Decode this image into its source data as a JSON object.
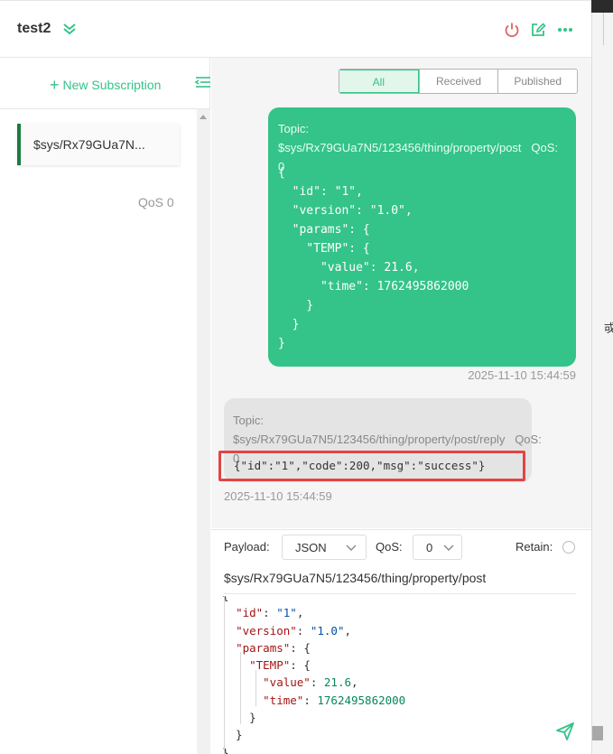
{
  "connection": {
    "name": "test2"
  },
  "header_icons": [
    "power-icon",
    "edit-icon",
    "more-icon"
  ],
  "subscriptions": {
    "new_label": "New Subscription",
    "items": [
      {
        "topic": "$sys/Rx79GUa7N...",
        "qos": "QoS 0"
      }
    ]
  },
  "filters": [
    "All",
    "Received",
    "Published"
  ],
  "messages": {
    "published": {
      "topic": "Topic: $sys/Rx79GUa7N5/123456/thing/property/post",
      "qos": "QoS: 0",
      "payload": "{\n  \"id\": \"1\",\n  \"version\": \"1.0\",\n  \"params\": {\n    \"TEMP\": {\n      \"value\": 21.6,\n      \"time\": 1762495862000\n    }\n  }\n}",
      "time": "2025-11-10 15:44:59"
    },
    "received": {
      "topic": "Topic: $sys/Rx79GUa7N5/123456/thing/property/post/reply",
      "qos": "QoS: 0",
      "payload": "{\"id\":\"1\",\"code\":200,\"msg\":\"success\"}",
      "time": "2025-11-10 15:44:59"
    }
  },
  "composer": {
    "payload_label": "Payload:",
    "payload_format": "JSON",
    "qos_label": "QoS:",
    "qos_value": "0",
    "retain_label": "Retain:",
    "topic": "$sys/Rx79GUa7N5/123456/thing/property/post"
  },
  "colors": {
    "accent": "#34c388",
    "highlight": "#e24444",
    "power": "#e0645f"
  },
  "external": {
    "char": "戓"
  }
}
